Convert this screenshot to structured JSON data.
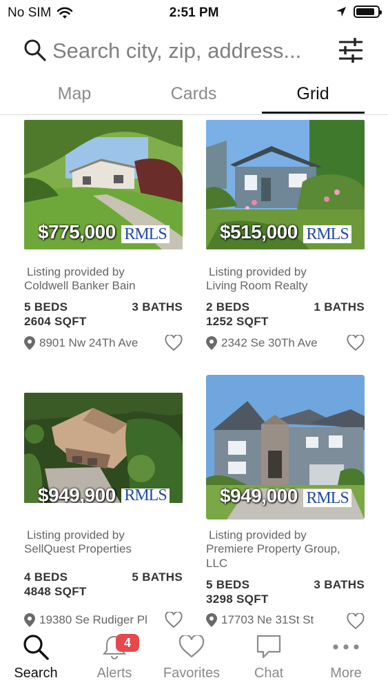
{
  "status_bar": {
    "carrier": "No SIM",
    "time": "2:51 PM"
  },
  "search": {
    "placeholder": "Search city, zip, address..."
  },
  "view_tabs": [
    {
      "label": "Map"
    },
    {
      "label": "Cards"
    },
    {
      "label": "Grid",
      "active": true
    }
  ],
  "listings": [
    {
      "price": "$775,000",
      "watermark": "RMLS",
      "provided_label": "Listing provided by",
      "broker": "Coldwell Banker Bain",
      "beds": "5 BEDS",
      "baths": "3 BATHS",
      "sqft": "2604 SQFT",
      "address": "8901 Nw 24Th Ave"
    },
    {
      "price": "$515,000",
      "watermark": "RMLS",
      "provided_label": "Listing provided by",
      "broker": "Living Room Realty",
      "beds": "2 BEDS",
      "baths": "1 BATHS",
      "sqft": "1252 SQFT",
      "address": "2342 Se 30Th Ave"
    },
    {
      "price": "$949,900",
      "watermark": "RMLS",
      "provided_label": "Listing provided by",
      "broker": "SellQuest Properties",
      "beds": "4 BEDS",
      "baths": "5 BATHS",
      "sqft": "4848 SQFT",
      "address": "19380 Se Rudiger Pl"
    },
    {
      "price": "$949,000",
      "watermark": "RMLS",
      "provided_label": "Listing provided by",
      "broker": "Premiere Property Group, LLC",
      "beds": "5 BEDS",
      "baths": "3 BATHS",
      "sqft": "3298 SQFT",
      "address": "17703 Ne 31St St"
    }
  ],
  "tab_bar": {
    "items": [
      {
        "label": "Search",
        "icon": "search-icon",
        "active": true
      },
      {
        "label": "Alerts",
        "icon": "bell-icon",
        "badge": "4"
      },
      {
        "label": "Favorites",
        "icon": "heart-icon"
      },
      {
        "label": "Chat",
        "icon": "chat-bubble-icon"
      },
      {
        "label": "More",
        "icon": "more-dots-icon"
      }
    ]
  },
  "colors": {
    "active_text": "#111111",
    "inactive_text": "#8a8a8a",
    "badge": "#e8474b",
    "rmls_blue": "#1f4aa8"
  }
}
